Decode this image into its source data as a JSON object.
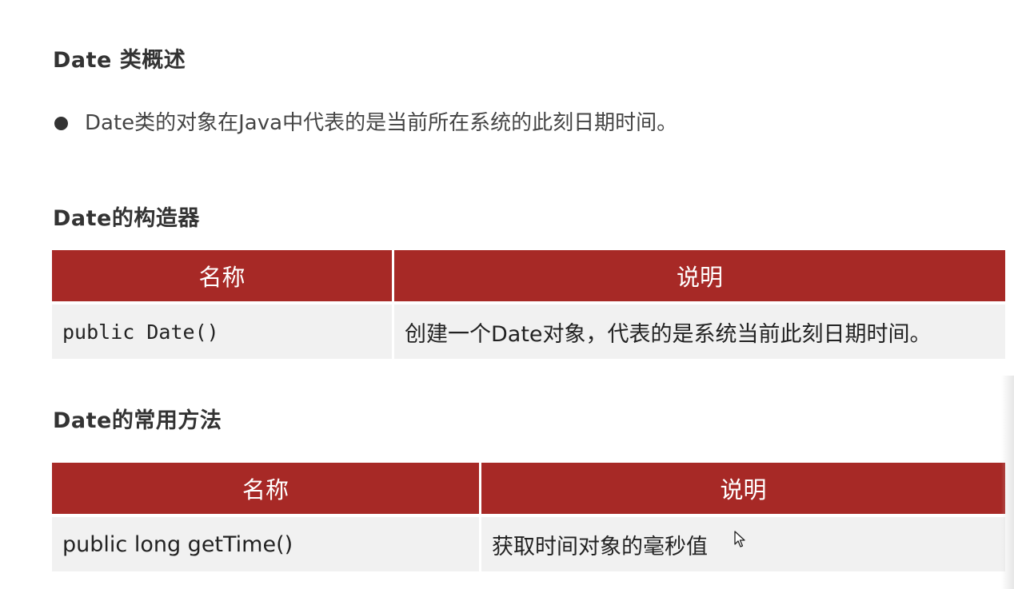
{
  "overview": {
    "heading": "Date 类概述",
    "bullet": "Date类的对象在Java中代表的是当前所在系统的此刻日期时间。"
  },
  "constructors": {
    "heading": "Date的构造器",
    "columns": [
      "名称",
      "说明"
    ],
    "rows": [
      [
        "public Date()",
        "创建一个Date对象，代表的是系统当前此刻日期时间。"
      ]
    ]
  },
  "methods": {
    "heading": "Date的常用方法",
    "columns": [
      "名称",
      "说明"
    ],
    "rows": [
      [
        "public long getTime()",
        "获取时间对象的毫秒值"
      ]
    ]
  },
  "colors": {
    "table_header": "#a72926",
    "table_row": "#f1f1f1",
    "text": "#333333"
  },
  "icons": {
    "pointer": "mouse-pointer-icon",
    "bullet": "bullet-dot-icon"
  }
}
